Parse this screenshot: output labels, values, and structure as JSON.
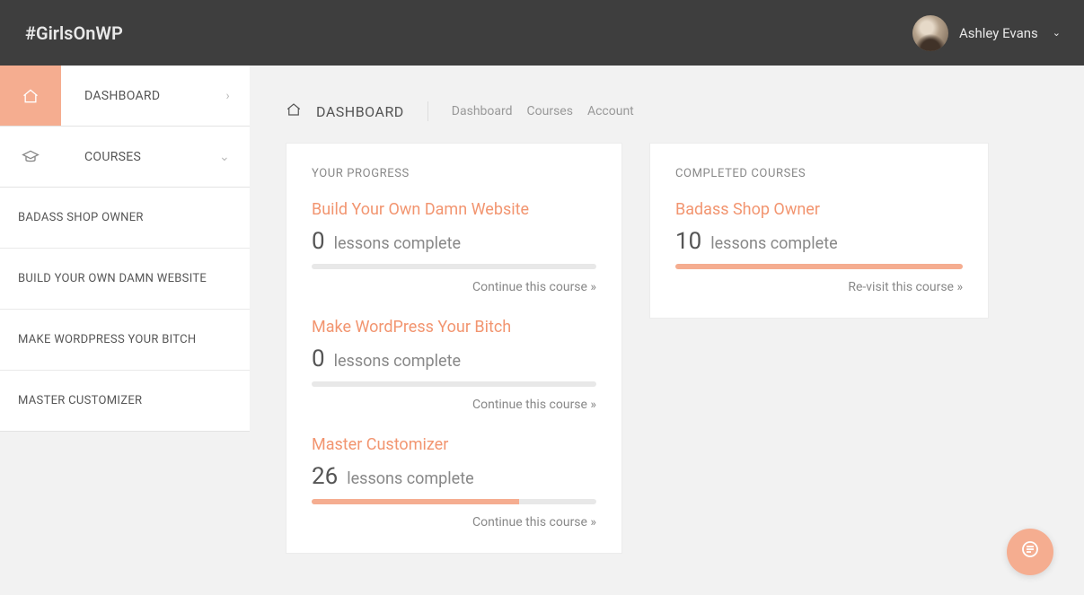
{
  "brand": "#GirlsOnWP",
  "user": {
    "name": "Ashley Evans"
  },
  "sidebar": {
    "dashboard_label": "DASHBOARD",
    "courses_label": "COURSES",
    "sub": [
      {
        "label": "BADASS SHOP OWNER"
      },
      {
        "label": "BUILD YOUR OWN DAMN WEBSITE"
      },
      {
        "label": "MAKE WORDPRESS YOUR BITCH"
      },
      {
        "label": "MASTER CUSTOMIZER"
      }
    ]
  },
  "breadcrumb": {
    "title": "DASHBOARD",
    "links": [
      {
        "label": "Dashboard"
      },
      {
        "label": "Courses"
      },
      {
        "label": "Account"
      }
    ]
  },
  "progress_card": {
    "title": "YOUR PROGRESS",
    "courses": [
      {
        "name": "Build Your Own Damn Website",
        "count": "0",
        "text": "lessons complete",
        "percent": 0,
        "cta": "Continue this course »"
      },
      {
        "name": "Make WordPress Your Bitch",
        "count": "0",
        "text": "lessons complete",
        "percent": 0,
        "cta": "Continue this course »"
      },
      {
        "name": "Master Customizer",
        "count": "26",
        "text": "lessons complete",
        "percent": 73,
        "cta": "Continue this course »"
      }
    ]
  },
  "completed_card": {
    "title": "COMPLETED COURSES",
    "courses": [
      {
        "name": "Badass Shop Owner",
        "count": "10",
        "text": "lessons complete",
        "percent": 100,
        "cta": "Re-visit this course »"
      }
    ]
  }
}
